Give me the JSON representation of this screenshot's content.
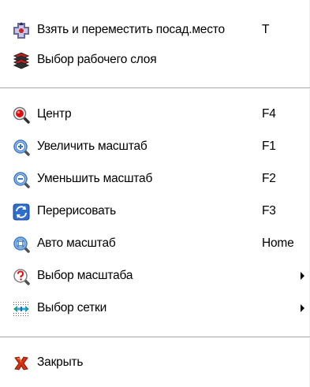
{
  "menu": {
    "items": [
      {
        "label": "Взять и переместить посад.место",
        "shortcut": "T",
        "icon": "move-pad-icon"
      },
      {
        "label": "Выбор рабочего слоя",
        "shortcut": "",
        "icon": "layers-icon"
      },
      {
        "label": "Центр",
        "shortcut": "F4",
        "icon": "zoom-center-icon"
      },
      {
        "label": "Увеличить масштаб",
        "shortcut": "F1",
        "icon": "zoom-in-icon"
      },
      {
        "label": "Уменьшить масштаб",
        "shortcut": "F2",
        "icon": "zoom-out-icon"
      },
      {
        "label": "Перерисовать",
        "shortcut": "F3",
        "icon": "redraw-icon"
      },
      {
        "label": "Авто масштаб",
        "shortcut": "Home",
        "icon": "zoom-auto-icon"
      },
      {
        "label": "Выбор масштаба",
        "shortcut": "",
        "icon": "zoom-select-icon",
        "submenu": true
      },
      {
        "label": "Выбор сетки",
        "shortcut": "",
        "icon": "grid-icon",
        "submenu": true
      },
      {
        "label": "Закрыть",
        "shortcut": "",
        "icon": "close-icon"
      }
    ]
  },
  "colors": {
    "background": "#ffffff",
    "separator": "#a8a8a8",
    "text": "#000000",
    "zoom_red": "#e01010",
    "zoom_blue": "#3a78c8",
    "close_red": "#d83010"
  }
}
